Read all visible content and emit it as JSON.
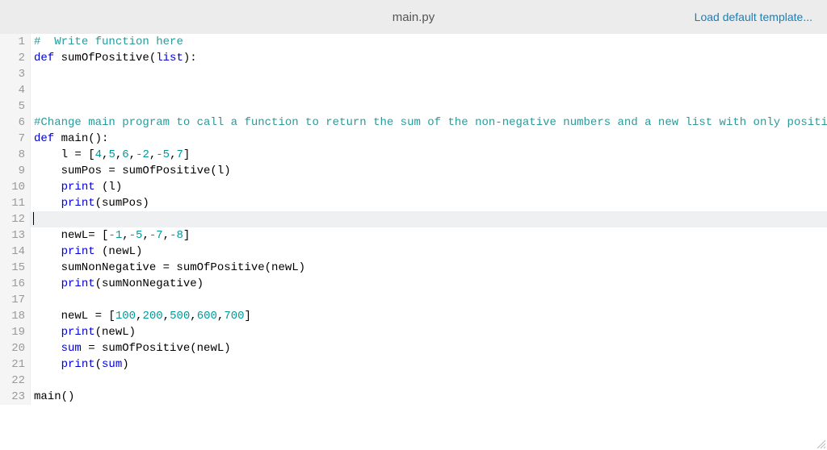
{
  "header": {
    "title": "main.py",
    "load_template": "Load default template..."
  },
  "editor": {
    "cursor_line": 12,
    "lines": [
      {
        "n": 1,
        "tokens": [
          {
            "t": "# ",
            "c": "c-comment"
          },
          {
            "t": " Write function here",
            "c": "c-comment"
          }
        ]
      },
      {
        "n": 2,
        "tokens": [
          {
            "t": "def ",
            "c": "c-keyword"
          },
          {
            "t": "sumOfPositive",
            "c": "c-def"
          },
          {
            "t": "(",
            "c": "c-paren"
          },
          {
            "t": "list",
            "c": "c-builtin"
          },
          {
            "t": "):",
            "c": "c-paren"
          }
        ]
      },
      {
        "n": 3,
        "tokens": [
          {
            "t": "",
            "c": ""
          }
        ]
      },
      {
        "n": 4,
        "tokens": [
          {
            "t": "",
            "c": ""
          }
        ]
      },
      {
        "n": 5,
        "tokens": [
          {
            "t": "",
            "c": ""
          }
        ]
      },
      {
        "n": 6,
        "tokens": [
          {
            "t": "#Change main program to call a function to return the sum of the non-negative numbers and a new list with only positive numbe",
            "c": "c-comment"
          }
        ]
      },
      {
        "n": 7,
        "tokens": [
          {
            "t": "def ",
            "c": "c-keyword"
          },
          {
            "t": "main",
            "c": "c-def"
          },
          {
            "t": "():",
            "c": "c-paren"
          }
        ]
      },
      {
        "n": 8,
        "tokens": [
          {
            "t": "    l = [",
            "c": "c-ident"
          },
          {
            "t": "4",
            "c": "c-num"
          },
          {
            "t": ",",
            "c": "c-ident"
          },
          {
            "t": "5",
            "c": "c-num"
          },
          {
            "t": ",",
            "c": "c-ident"
          },
          {
            "t": "6",
            "c": "c-num"
          },
          {
            "t": ",",
            "c": "c-ident"
          },
          {
            "t": "-2",
            "c": "c-num"
          },
          {
            "t": ",",
            "c": "c-ident"
          },
          {
            "t": "-5",
            "c": "c-num"
          },
          {
            "t": ",",
            "c": "c-ident"
          },
          {
            "t": "7",
            "c": "c-num"
          },
          {
            "t": "]",
            "c": "c-ident"
          }
        ]
      },
      {
        "n": 9,
        "tokens": [
          {
            "t": "    sumPos = sumOfPositive(l)",
            "c": "c-ident"
          }
        ]
      },
      {
        "n": 10,
        "tokens": [
          {
            "t": "    ",
            "c": ""
          },
          {
            "t": "print",
            "c": "c-builtin"
          },
          {
            "t": " (l)",
            "c": "c-ident"
          }
        ]
      },
      {
        "n": 11,
        "tokens": [
          {
            "t": "    ",
            "c": ""
          },
          {
            "t": "print",
            "c": "c-builtin"
          },
          {
            "t": "(sumPos)",
            "c": "c-ident"
          }
        ]
      },
      {
        "n": 12,
        "tokens": [
          {
            "t": "",
            "c": ""
          }
        ],
        "cursor": true
      },
      {
        "n": 13,
        "tokens": [
          {
            "t": "    newL= [",
            "c": "c-ident"
          },
          {
            "t": "-1",
            "c": "c-num"
          },
          {
            "t": ",",
            "c": "c-ident"
          },
          {
            "t": "-5",
            "c": "c-num"
          },
          {
            "t": ",",
            "c": "c-ident"
          },
          {
            "t": "-7",
            "c": "c-num"
          },
          {
            "t": ",",
            "c": "c-ident"
          },
          {
            "t": "-8",
            "c": "c-num"
          },
          {
            "t": "]",
            "c": "c-ident"
          }
        ]
      },
      {
        "n": 14,
        "tokens": [
          {
            "t": "    ",
            "c": ""
          },
          {
            "t": "print",
            "c": "c-builtin"
          },
          {
            "t": " (newL)",
            "c": "c-ident"
          }
        ]
      },
      {
        "n": 15,
        "tokens": [
          {
            "t": "    sumNonNegative = sumOfPositive(newL)",
            "c": "c-ident"
          }
        ]
      },
      {
        "n": 16,
        "tokens": [
          {
            "t": "    ",
            "c": ""
          },
          {
            "t": "print",
            "c": "c-builtin"
          },
          {
            "t": "(sumNonNegative)",
            "c": "c-ident"
          }
        ]
      },
      {
        "n": 17,
        "tokens": [
          {
            "t": "",
            "c": ""
          }
        ]
      },
      {
        "n": 18,
        "tokens": [
          {
            "t": "    newL = [",
            "c": "c-ident"
          },
          {
            "t": "100",
            "c": "c-num"
          },
          {
            "t": ",",
            "c": "c-ident"
          },
          {
            "t": "200",
            "c": "c-num"
          },
          {
            "t": ",",
            "c": "c-ident"
          },
          {
            "t": "500",
            "c": "c-num"
          },
          {
            "t": ",",
            "c": "c-ident"
          },
          {
            "t": "600",
            "c": "c-num"
          },
          {
            "t": ",",
            "c": "c-ident"
          },
          {
            "t": "700",
            "c": "c-num"
          },
          {
            "t": "]",
            "c": "c-ident"
          }
        ]
      },
      {
        "n": 19,
        "tokens": [
          {
            "t": "    ",
            "c": ""
          },
          {
            "t": "print",
            "c": "c-builtin"
          },
          {
            "t": "(newL)",
            "c": "c-ident"
          }
        ]
      },
      {
        "n": 20,
        "tokens": [
          {
            "t": "    ",
            "c": ""
          },
          {
            "t": "sum",
            "c": "c-builtin"
          },
          {
            "t": " = sumOfPositive(newL)",
            "c": "c-ident"
          }
        ]
      },
      {
        "n": 21,
        "tokens": [
          {
            "t": "    ",
            "c": ""
          },
          {
            "t": "print",
            "c": "c-builtin"
          },
          {
            "t": "(",
            "c": "c-ident"
          },
          {
            "t": "sum",
            "c": "c-builtin"
          },
          {
            "t": ")",
            "c": "c-ident"
          }
        ]
      },
      {
        "n": 22,
        "tokens": [
          {
            "t": "",
            "c": ""
          }
        ]
      },
      {
        "n": 23,
        "tokens": [
          {
            "t": "main()",
            "c": "c-ident"
          }
        ]
      }
    ]
  }
}
